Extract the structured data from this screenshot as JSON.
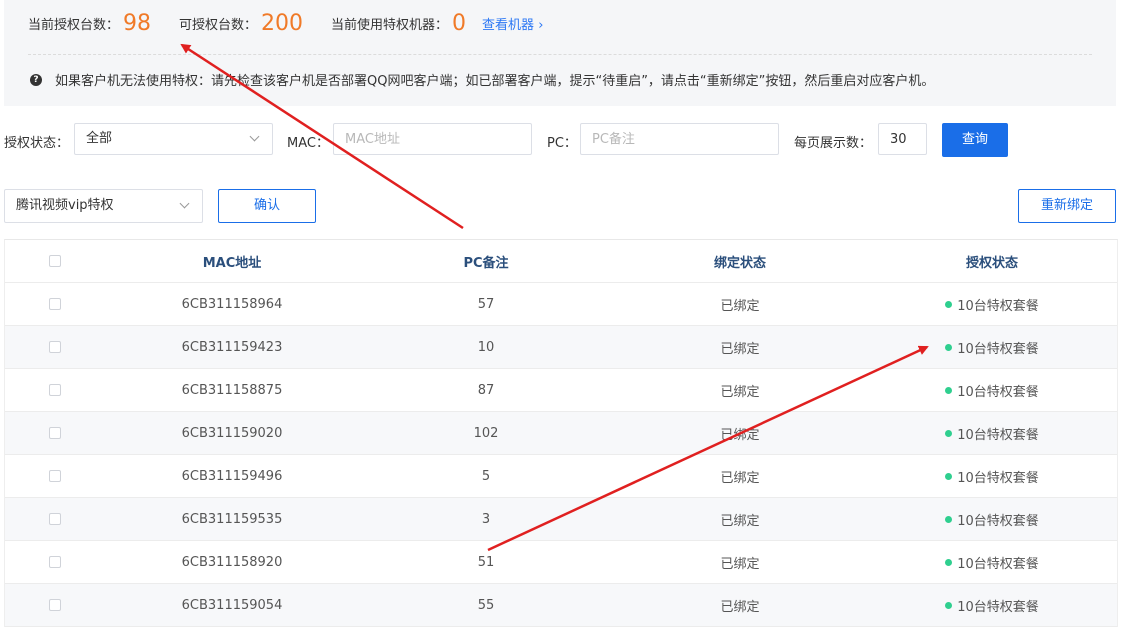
{
  "stats": {
    "current_label": "当前授权台数：",
    "current_value": "98",
    "available_label": "可授权台数：",
    "available_value": "200",
    "using_label": "当前使用特权机器：",
    "using_value": "0",
    "view_link": "查看机器"
  },
  "notice": {
    "icon": "question-circle-icon",
    "text": "如果客户机无法使用特权：请先检查该客户机是否部署QQ网吧客户端；如已部署客户端，提示“待重启”，请点击“重新绑定”按钮，然后重启对应客户机。"
  },
  "filters": {
    "auth_status_label": "授权状态：",
    "auth_status_value": "全部",
    "mac_label": "MAC：",
    "mac_placeholder": "MAC地址",
    "pc_label": "PC：",
    "pc_placeholder": "PC备注",
    "page_size_label": "每页展示数：",
    "page_size_value": "30",
    "query_button": "查询"
  },
  "actions": {
    "privilege_select_value": "腾讯视频vip特权",
    "confirm_button": "确认",
    "rebind_button": "重新绑定"
  },
  "table": {
    "headers": {
      "mac": "MAC地址",
      "pc": "PC备注",
      "bind": "绑定状态",
      "auth": "授权状态"
    },
    "rows": [
      {
        "mac": "6CB311158964",
        "pc": "57",
        "bind": "已绑定",
        "auth": "10台特权套餐"
      },
      {
        "mac": "6CB311159423",
        "pc": "10",
        "bind": "已绑定",
        "auth": "10台特权套餐"
      },
      {
        "mac": "6CB311158875",
        "pc": "87",
        "bind": "已绑定",
        "auth": "10台特权套餐"
      },
      {
        "mac": "6CB311159020",
        "pc": "102",
        "bind": "已绑定",
        "auth": "10台特权套餐"
      },
      {
        "mac": "6CB311159496",
        "pc": "5",
        "bind": "已绑定",
        "auth": "10台特权套餐"
      },
      {
        "mac": "6CB311159535",
        "pc": "3",
        "bind": "已绑定",
        "auth": "10台特权套餐"
      },
      {
        "mac": "6CB311158920",
        "pc": "51",
        "bind": "已绑定",
        "auth": "10台特权套餐"
      },
      {
        "mac": "6CB311159054",
        "pc": "55",
        "bind": "已绑定",
        "auth": "10台特权套餐"
      }
    ]
  },
  "colors": {
    "accent": "#1a6ee8",
    "stat_number": "#f07a28",
    "status_dot": "#2fcf8f",
    "annotation_arrow": "#e02020"
  }
}
